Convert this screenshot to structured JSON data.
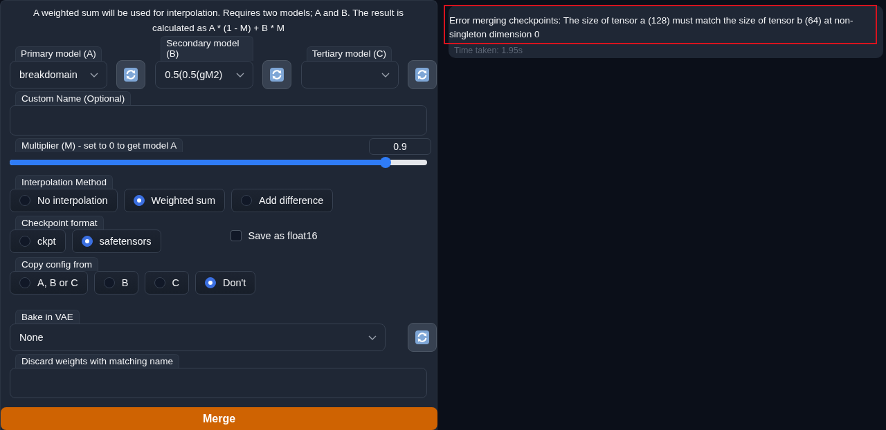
{
  "description": {
    "text": "A weighted sum will be used for interpolation. Requires two models; A and B. The result is calculated as A * (1 - M) + B * M"
  },
  "models": [
    {
      "label": "Primary model (A)",
      "value": "breakdomain"
    },
    {
      "label": "Secondary model (B)",
      "value": "0.5(0.5(gM2)"
    },
    {
      "label": "Tertiary model (C)"
    }
  ],
  "custom_name": {
    "label": "Custom Name (Optional)"
  },
  "multiplier": {
    "label": "Multiplier (M) - set to 0 to get model A",
    "value": "0.9",
    "level": 0.9
  },
  "radio_groups": [
    {
      "label": "Interpolation Method",
      "options": [
        {
          "label": "No interpolation",
          "selected": false
        },
        {
          "label": "Weighted sum",
          "selected": true
        },
        {
          "label": "Add difference",
          "selected": false
        }
      ]
    },
    {
      "label": "Checkpoint format",
      "options": [
        {
          "label": "ckpt",
          "selected": false
        },
        {
          "label": "safetensors",
          "selected": true
        }
      ]
    },
    {
      "label": "Copy config from",
      "options": [
        {
          "label": "A, B or C",
          "selected": false
        },
        {
          "label": "B",
          "selected": false
        },
        {
          "label": "C",
          "selected": false
        },
        {
          "label": "Don't",
          "selected": true
        }
      ]
    }
  ],
  "save_float16": {
    "label": "Save as float16",
    "checked": false
  },
  "bake_vae": {
    "label": "Bake in VAE",
    "value": "None"
  },
  "discard_weights": {
    "label": "Discard weights with matching name"
  },
  "merge_button": {
    "label": "Merge"
  },
  "output": {
    "message": "Error merging checkpoints: The size of tensor a (128) must match the size of tensor b (64) at non-singleton dimension 0",
    "time": "Time taken: 1.95s",
    "highlighted": true
  }
}
